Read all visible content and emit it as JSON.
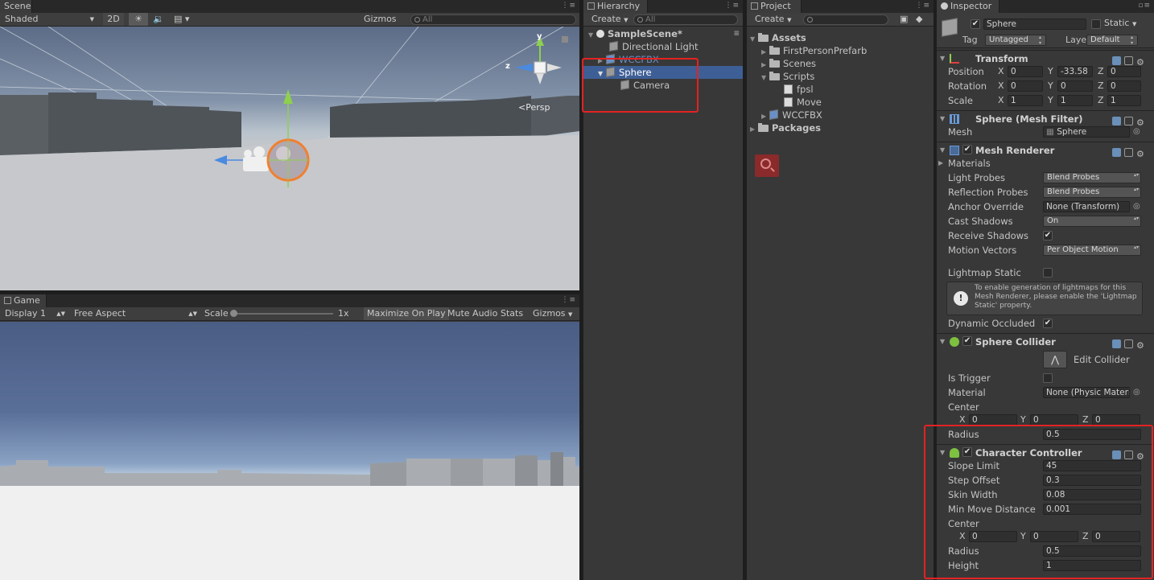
{
  "scene": {
    "tab": "Scene",
    "shading": "Shaded",
    "mode_2d": "2D",
    "gizmos": "Gizmos",
    "search_placeholder": "All",
    "persp_label": "Persp",
    "axis_y": "y",
    "axis_z": "z"
  },
  "game": {
    "tab": "Game",
    "display": "Display 1",
    "aspect": "Free Aspect",
    "scale_label": "Scale",
    "scale_value": "1x",
    "maximize": "Maximize On Play",
    "mute": "Mute Audio",
    "stats": "Stats",
    "gizmos": "Gizmos"
  },
  "hierarchy": {
    "tab": "Hierarchy",
    "create": "Create",
    "search_placeholder": "All",
    "scene_name": "SampleScene*",
    "items": [
      {
        "label": "Directional Light"
      },
      {
        "label": "WCCFBX"
      },
      {
        "label": "Sphere"
      },
      {
        "label": "Camera"
      }
    ]
  },
  "project": {
    "tab": "Project",
    "create": "Create",
    "items": [
      {
        "label": "Assets"
      },
      {
        "label": "FirstPersonPrefarb"
      },
      {
        "label": "Scenes"
      },
      {
        "label": "Scripts"
      },
      {
        "label": "fpsl"
      },
      {
        "label": "Move"
      },
      {
        "label": "WCCFBX"
      },
      {
        "label": "Packages"
      }
    ]
  },
  "inspector": {
    "tab": "Inspector",
    "object_name": "Sphere",
    "static_label": "Static",
    "tag_label": "Tag",
    "tag_value": "Untagged",
    "layer_label": "Layer",
    "layer_value": "Default",
    "transform": {
      "title": "Transform",
      "position_label": "Position",
      "rotation_label": "Rotation",
      "scale_label": "Scale",
      "position": [
        "0",
        "-33.58",
        "0"
      ],
      "rotation": [
        "0",
        "0",
        "0"
      ],
      "scale": [
        "1",
        "1",
        "1"
      ]
    },
    "axes": [
      "X",
      "Y",
      "Z"
    ],
    "mesh_filter": {
      "title": "Sphere (Mesh Filter)",
      "mesh_label": "Mesh",
      "mesh_value": "Sphere"
    },
    "mesh_renderer": {
      "title": "Mesh Renderer",
      "materials": "Materials",
      "light_probes_label": "Light Probes",
      "light_probes_value": "Blend Probes",
      "reflection_probes_label": "Reflection Probes",
      "reflection_probes_value": "Blend Probes",
      "anchor_override_label": "Anchor Override",
      "anchor_override_value": "None (Transform)",
      "cast_shadows_label": "Cast Shadows",
      "cast_shadows_value": "On",
      "receive_shadows_label": "Receive Shadows",
      "motion_vectors_label": "Motion Vectors",
      "motion_vectors_value": "Per Object Motion",
      "lightmap_static_label": "Lightmap Static",
      "info": "To enable generation of lightmaps for this Mesh Renderer, please enable the 'Lightmap Static' property.",
      "dynamic_occluded_label": "Dynamic Occluded"
    },
    "sphere_collider": {
      "title": "Sphere Collider",
      "edit_collider": "Edit Collider",
      "is_trigger_label": "Is Trigger",
      "material_label": "Material",
      "material_value": "None (Physic Material)",
      "center_label": "Center",
      "center": [
        "0",
        "0",
        "0"
      ],
      "radius_label": "Radius",
      "radius_value": "0.5"
    },
    "character_controller": {
      "title": "Character Controller",
      "slope_limit_label": "Slope Limit",
      "slope_limit_value": "45",
      "step_offset_label": "Step Offset",
      "step_offset_value": "0.3",
      "skin_width_label": "Skin Width",
      "skin_width_value": "0.08",
      "min_move_label": "Min Move Distance",
      "min_move_value": "0.001",
      "center_label": "Center",
      "center": [
        "0",
        "0",
        "0"
      ],
      "radius_label": "Radius",
      "radius_value": "0.5",
      "height_label": "Height",
      "height_value": "1"
    }
  },
  "colors": {
    "selection": "#3e5f96",
    "highlight_box": "#e52222",
    "panel_bg": "#383838"
  }
}
